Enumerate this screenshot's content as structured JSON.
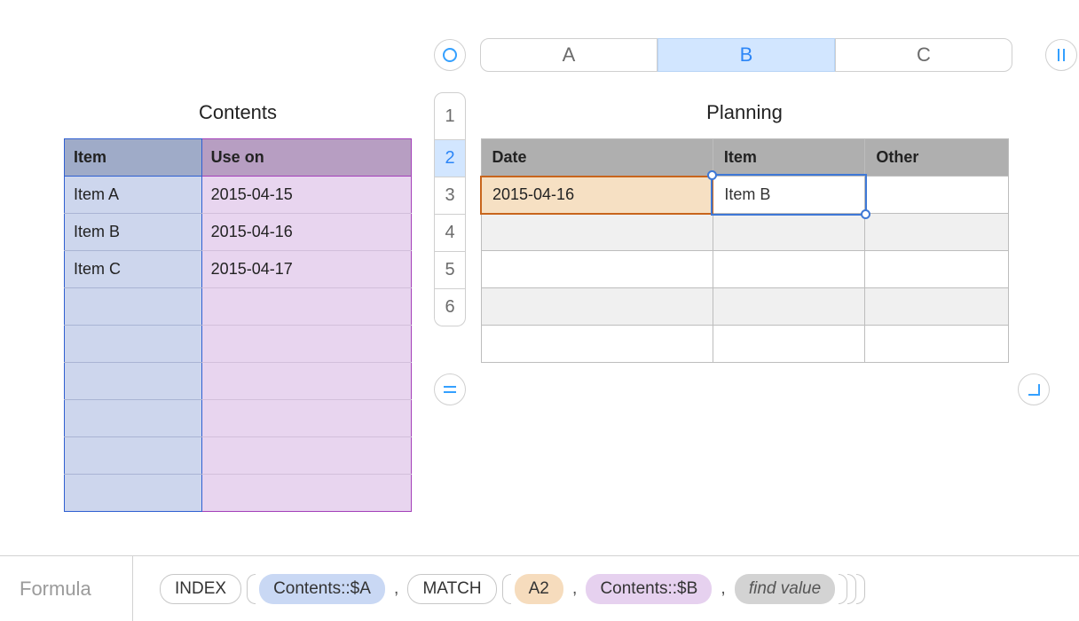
{
  "contents": {
    "title": "Contents",
    "headers": {
      "item": "Item",
      "use_on": "Use on"
    },
    "rows": [
      {
        "item": "Item A",
        "use_on": "2015-04-15"
      },
      {
        "item": "Item B",
        "use_on": "2015-04-16"
      },
      {
        "item": "Item C",
        "use_on": "2015-04-17"
      },
      {
        "item": "",
        "use_on": ""
      },
      {
        "item": "",
        "use_on": ""
      },
      {
        "item": "",
        "use_on": ""
      },
      {
        "item": "",
        "use_on": ""
      },
      {
        "item": "",
        "use_on": ""
      },
      {
        "item": "",
        "use_on": ""
      }
    ]
  },
  "columns": {
    "a": "A",
    "b": "B",
    "c": "C"
  },
  "rownums": {
    "r1": "1",
    "r2": "2",
    "r3": "3",
    "r4": "4",
    "r5": "5",
    "r6": "6"
  },
  "planning": {
    "title": "Planning",
    "headers": {
      "date": "Date",
      "item": "Item",
      "other": "Other"
    },
    "rows": [
      {
        "date": "2015-04-16",
        "item": "Item B",
        "other": ""
      },
      {
        "date": "",
        "item": "",
        "other": ""
      },
      {
        "date": "",
        "item": "",
        "other": ""
      },
      {
        "date": "",
        "item": "",
        "other": ""
      },
      {
        "date": "",
        "item": "",
        "other": ""
      }
    ]
  },
  "formula": {
    "label": "Formula",
    "tokens": {
      "index": "INDEX",
      "ref1": "Contents::$A",
      "match": "MATCH",
      "ref2": "A2",
      "ref3": "Contents::$B",
      "find": "find value"
    }
  }
}
